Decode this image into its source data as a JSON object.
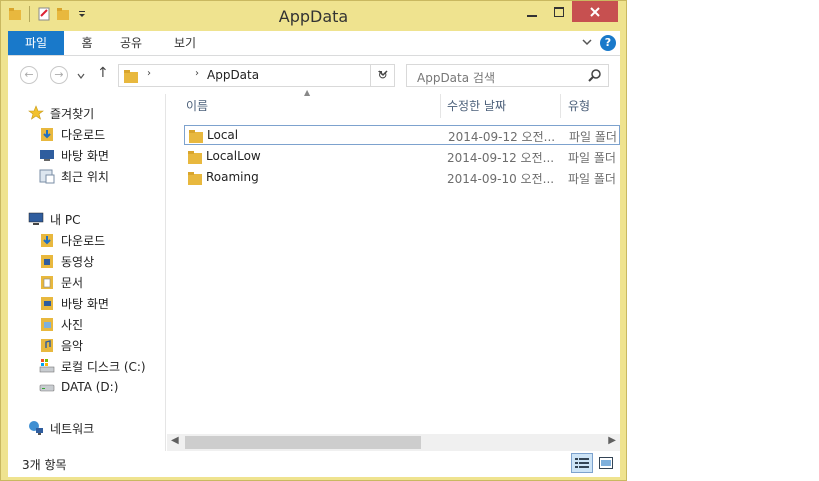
{
  "window": {
    "title": "AppData"
  },
  "ribbon": {
    "tabs": [
      {
        "label": "파일"
      },
      {
        "label": "홈"
      },
      {
        "label": "공유"
      },
      {
        "label": "보기"
      }
    ]
  },
  "address": {
    "crumb": "AppData",
    "search_placeholder": "AppData 검색"
  },
  "nav": {
    "favorites": {
      "label": "즐겨찾기",
      "items": [
        {
          "label": "다운로드",
          "icon": "download-folder-icon"
        },
        {
          "label": "바탕 화면",
          "icon": "desktop-icon"
        },
        {
          "label": "최근 위치",
          "icon": "recent-places-icon"
        }
      ]
    },
    "pc": {
      "label": "내 PC",
      "items": [
        {
          "label": "다운로드",
          "icon": "download-folder-icon"
        },
        {
          "label": "동영상",
          "icon": "videos-folder-icon"
        },
        {
          "label": "문서",
          "icon": "documents-folder-icon"
        },
        {
          "label": "바탕 화면",
          "icon": "desktop-folder-icon"
        },
        {
          "label": "사진",
          "icon": "pictures-folder-icon"
        },
        {
          "label": "음악",
          "icon": "music-folder-icon"
        },
        {
          "label": "로컬 디스크 (C:)",
          "icon": "local-disk-icon"
        },
        {
          "label": "DATA (D:)",
          "icon": "drive-icon"
        }
      ]
    },
    "network": {
      "label": "네트워크"
    }
  },
  "columns": {
    "name": "이름",
    "modified": "수정한 날짜",
    "type": "유형"
  },
  "files": [
    {
      "name": "Local",
      "modified": "2014-09-12 오전...",
      "type": "파일 폴더"
    },
    {
      "name": "LocalLow",
      "modified": "2014-09-12 오전...",
      "type": "파일 폴더"
    },
    {
      "name": "Roaming",
      "modified": "2014-09-10 오전...",
      "type": "파일 폴더"
    }
  ],
  "status": {
    "item_count": "3개 항목"
  },
  "colors": {
    "frame": "#efe38f",
    "file_tab": "#1979ca",
    "close_button": "#c75050",
    "selection_border": "#7da2ce",
    "column_header_text": "#4c607a",
    "folder": "#e8b83e"
  }
}
